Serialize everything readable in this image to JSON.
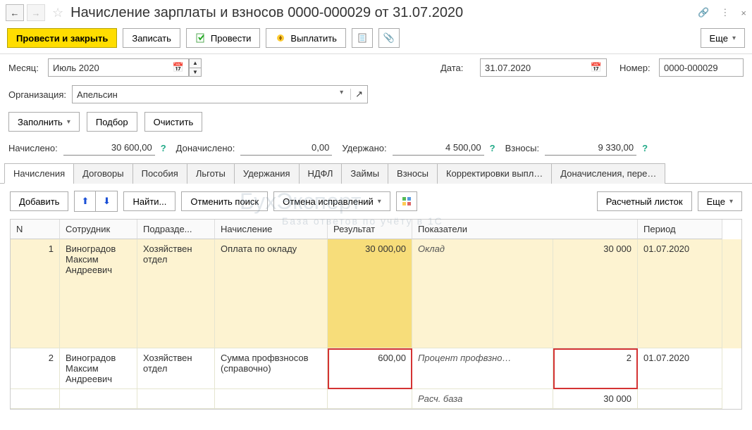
{
  "title": "Начисление зарплаты и взносов 0000-000029 от 31.07.2020",
  "toolbar": {
    "submit_close": "Провести и закрыть",
    "save": "Записать",
    "submit": "Провести",
    "pay": "Выплатить",
    "more": "Еще"
  },
  "form": {
    "month_label": "Месяц:",
    "month_value": "Июль 2020",
    "date_label": "Дата:",
    "date_value": "31.07.2020",
    "number_label": "Номер:",
    "number_value": "0000-000029",
    "org_label": "Организация:",
    "org_value": "Апельсин"
  },
  "actions": {
    "fill": "Заполнить",
    "pick": "Подбор",
    "clear": "Очистить"
  },
  "totals": {
    "accrued_label": "Начислено:",
    "accrued_value": "30 600,00",
    "extra_accrued_label": "Доначислено:",
    "extra_accrued_value": "0,00",
    "withheld_label": "Удержано:",
    "withheld_value": "4 500,00",
    "contrib_label": "Взносы:",
    "contrib_value": "9 330,00"
  },
  "tabs": [
    "Начисления",
    "Договоры",
    "Пособия",
    "Льготы",
    "Удержания",
    "НДФЛ",
    "Займы",
    "Взносы",
    "Корректировки выпл…",
    "Доначисления, пере…"
  ],
  "subtoolbar": {
    "add": "Добавить",
    "find": "Найти...",
    "cancel_search": "Отменить поиск",
    "cancel_fix": "Отмена исправлений",
    "payslip": "Расчетный листок",
    "more": "Еще"
  },
  "grid": {
    "headers": [
      "N",
      "Сотрудник",
      "Подразде...",
      "Начисление",
      "Результат",
      "Показатели",
      "",
      "Период"
    ],
    "rows": [
      {
        "n": "1",
        "employee": "Виноградов Максим Андреевич",
        "dept": "Хозяйствен отдел",
        "accrual": "Оплата по окладу",
        "result": "30 000,00",
        "indicator_name": "Оклад",
        "indicator_value": "30 000",
        "period": "01.07.2020"
      },
      {
        "n": "2",
        "employee": "Виноградов Максим Андреевич",
        "dept": "Хозяйствен отдел",
        "accrual": "Сумма профвзносов (справочно)",
        "result": "600,00",
        "indicator_name": "Процент профвзно…",
        "indicator_value": "2",
        "indicator_name2": "Расч. база",
        "indicator_value2": "30 000",
        "period": "01.07.2020"
      }
    ]
  },
  "watermark": "БухЭксперт",
  "watermark_sub": "База ответов по учёту в 1С"
}
